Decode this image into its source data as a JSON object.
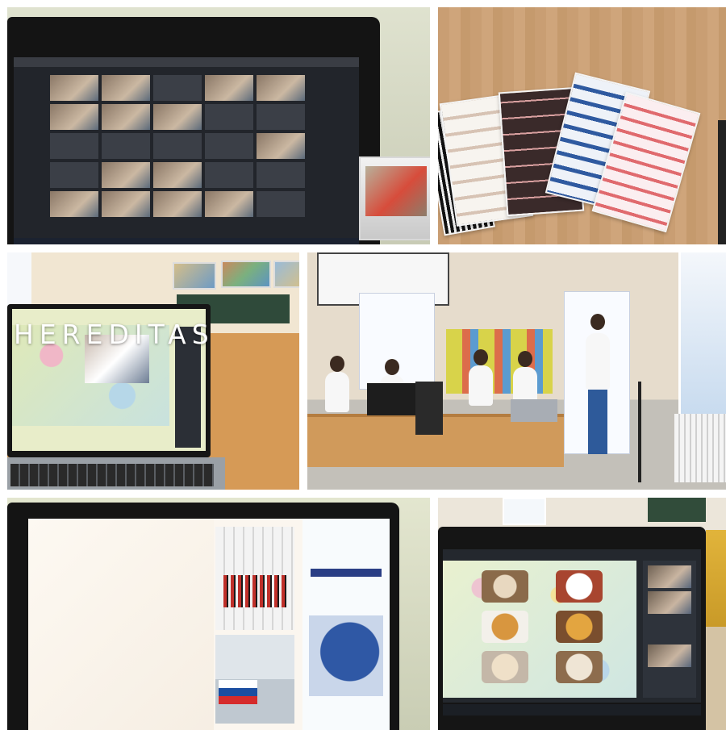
{
  "collage_title": "HEREDITAS",
  "colors": {
    "background": "#ffffff",
    "title_text": "#ffffff",
    "programme_link": "#c44040",
    "eu_blue": "#2a3e85"
  },
  "photos": [
    {
      "id": "video-call-laptop"
    },
    {
      "id": "printed-sheets"
    },
    {
      "id": "classroom-laptop"
    },
    {
      "id": "stage-presentation"
    },
    {
      "id": "programme-slide-laptop"
    },
    {
      "id": "food-slides-laptop"
    }
  ]
}
